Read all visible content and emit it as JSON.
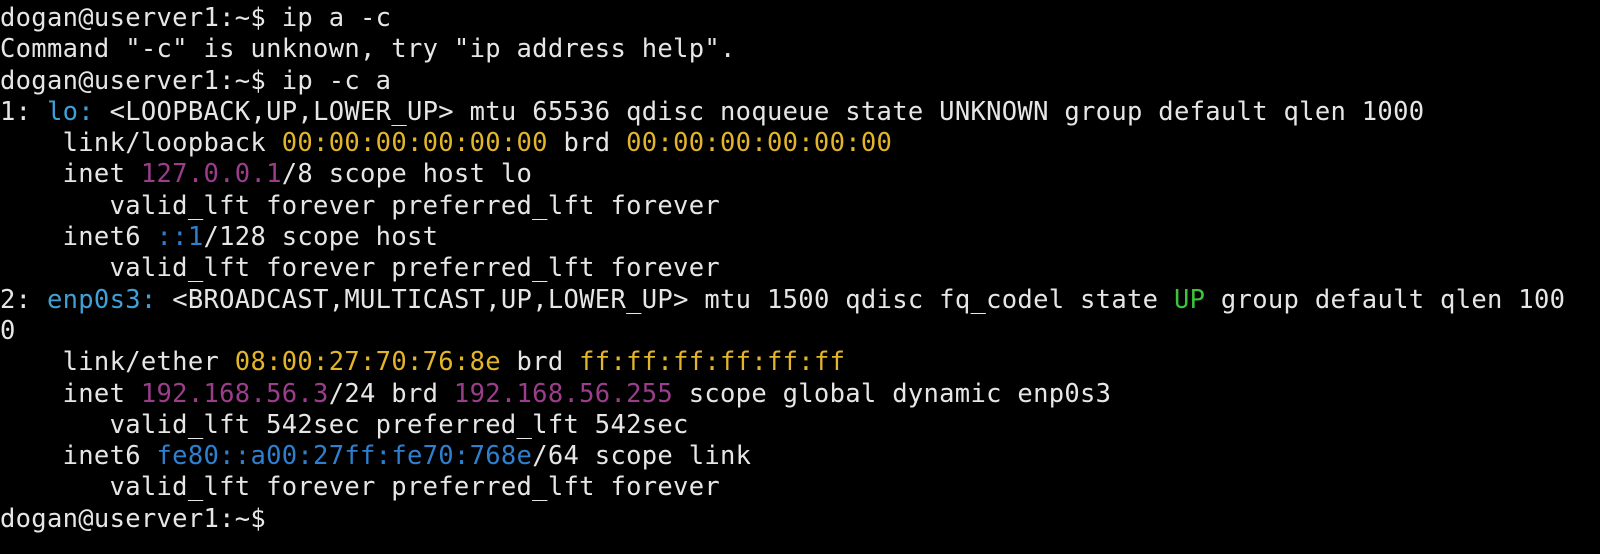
{
  "terminal": {
    "prompt": "dogan@userver1:~$ ",
    "cmd1": "ip a -c",
    "error": "Command \"-c\" is unknown, try \"ip address help\".",
    "cmd2": "ip -c a",
    "if1": {
      "index": "1: ",
      "name": "lo:",
      "flags": " <LOOPBACK,UP,LOWER_UP> mtu 65536 qdisc noqueue state UNKNOWN group default qlen 1000",
      "link_prefix": "    link/loopback ",
      "mac": "00:00:00:00:00:00",
      "brd_label": " brd ",
      "brd": "00:00:00:00:00:00",
      "inet_prefix": "    inet ",
      "ipv4": "127.0.0.1",
      "inet_suffix": "/8 scope host lo",
      "valid1": "       valid_lft forever preferred_lft forever",
      "inet6_prefix": "    inet6 ",
      "ipv6": "::1",
      "inet6_suffix": "/128 scope host",
      "valid2": "       valid_lft forever preferred_lft forever"
    },
    "if2": {
      "index": "2: ",
      "name": "enp0s3:",
      "flags_a": " <BROADCAST,MULTICAST,UP,LOWER_UP> mtu 1500 qdisc fq_codel state ",
      "state": "UP",
      "flags_b": " group default qlen 100",
      "wrap": "0",
      "link_prefix": "    link/ether ",
      "mac": "08:00:27:70:76:8e",
      "brd_label": " brd ",
      "brd": "ff:ff:ff:ff:ff:ff",
      "inet_prefix": "    inet ",
      "ipv4": "192.168.56.3",
      "inet_mid": "/24 brd ",
      "ipv4_brd": "192.168.56.255",
      "inet_suffix": " scope global dynamic enp0s3",
      "valid1": "       valid_lft 542sec preferred_lft 542sec",
      "inet6_prefix": "    inet6 ",
      "ipv6": "fe80::a00:27ff:fe70:768e",
      "inet6_suffix": "/64 scope link",
      "valid2": "       valid_lft forever preferred_lft forever"
    },
    "final_prompt": "dogan@userver1:~$ "
  },
  "colors": {
    "background": "#000000",
    "text": "#e6e6e6",
    "interface": "#3fa0d6",
    "mac": "#e3b52a",
    "ipv4": "#9a3d8a",
    "ipv6": "#2f7fcf",
    "state_up": "#3cc43c"
  }
}
